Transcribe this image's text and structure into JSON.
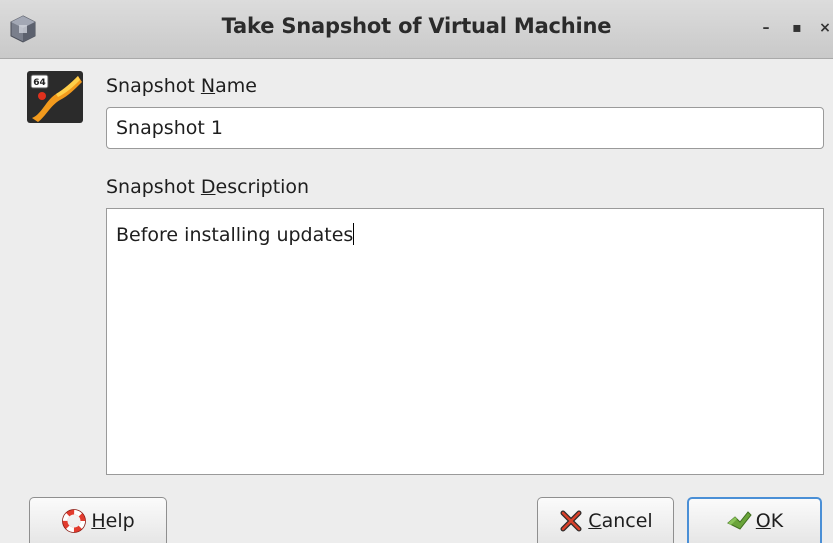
{
  "window": {
    "title": "Take Snapshot of Virtual Machine",
    "minimize_glyph": "–",
    "maximize_glyph": "▪",
    "close_glyph": "×"
  },
  "vm_icon": {
    "badge_text": "64",
    "icon_name": "virtualbox-vm-64bit-icon"
  },
  "form": {
    "name_label_prefix": "Snapshot ",
    "name_label_mnemonic": "N",
    "name_label_suffix": "ame",
    "name_value": "Snapshot 1",
    "desc_label_prefix": "Snapshot ",
    "desc_label_mnemonic": "D",
    "desc_label_suffix": "escription",
    "desc_value": "Before installing updates"
  },
  "buttons": {
    "help": {
      "mnemonic": "H",
      "rest": "elp",
      "icon": "help-lifebuoy-icon"
    },
    "cancel": {
      "mnemonic": "C",
      "rest": "ancel",
      "icon": "cancel-x-icon"
    },
    "ok": {
      "mnemonic": "O",
      "rest": "K",
      "icon": "ok-checkmark-icon"
    }
  },
  "colors": {
    "titlebar": "#d2d2d2",
    "background": "#ededed",
    "focus_accent": "#4a8fd6",
    "vm_orange": "#f29a1d"
  }
}
